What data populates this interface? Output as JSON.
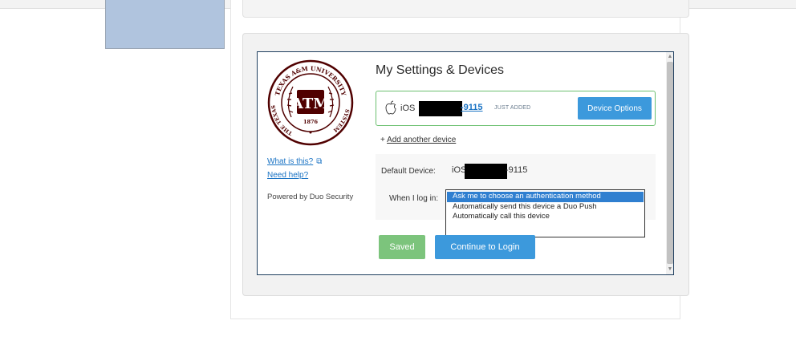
{
  "sidebar": {
    "what_is_this": "What is this?",
    "need_help": "Need help?",
    "powered_by": "Powered by Duo Security"
  },
  "main": {
    "title": "My Settings & Devices",
    "device": {
      "icon": "apple-icon",
      "platform": "iOS",
      "number_suffix": "-9115",
      "badge": "JUST ADDED",
      "options_label": "Device Options"
    },
    "add_device_prefix": "+ ",
    "add_device_label": "Add another device",
    "default_device_label": "Default Device:",
    "default_device_platform": "iOS",
    "default_device_suffix": "-9115",
    "when_login_label": "When I log in:",
    "login_options": [
      "Ask me to choose an authentication method",
      "Automatically send this device a Duo Push",
      "Automatically call this device"
    ],
    "selected_option": "Ask me to choose an authentication method",
    "saved_label": "Saved",
    "continue_label": "Continue to Login"
  },
  "seal": {
    "top_text": "TEXAS A&M UNIVERSITY",
    "left_text": "THE TEXAS",
    "right_text": "SYSTEM",
    "center_text": "ATM",
    "year": "1876"
  },
  "colors": {
    "maroon": "#500000",
    "accent_blue": "#3c99dc",
    "saved_green": "#7cc47c",
    "device_border_green": "#6cc070"
  }
}
